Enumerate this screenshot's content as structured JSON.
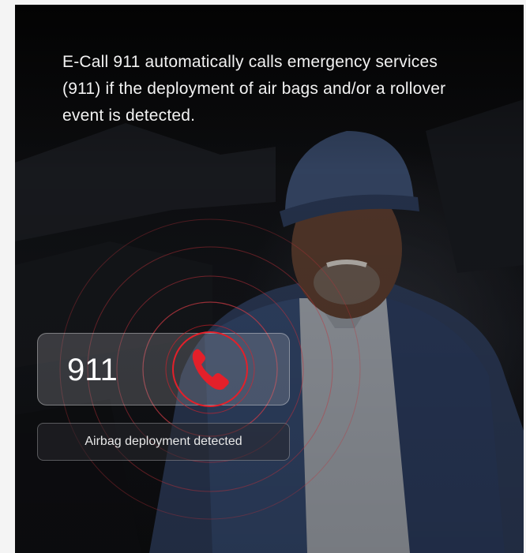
{
  "hero": {
    "headline": "E-Call 911 automatically calls emergency services (911) if the deployment of air bags and/or a rollover event is detected."
  },
  "call_card": {
    "number": "911",
    "icon": "phone-icon"
  },
  "status": {
    "text": "Airbag deployment detected"
  },
  "colors": {
    "accent": "#e3202a",
    "ring": "#c0303a"
  }
}
